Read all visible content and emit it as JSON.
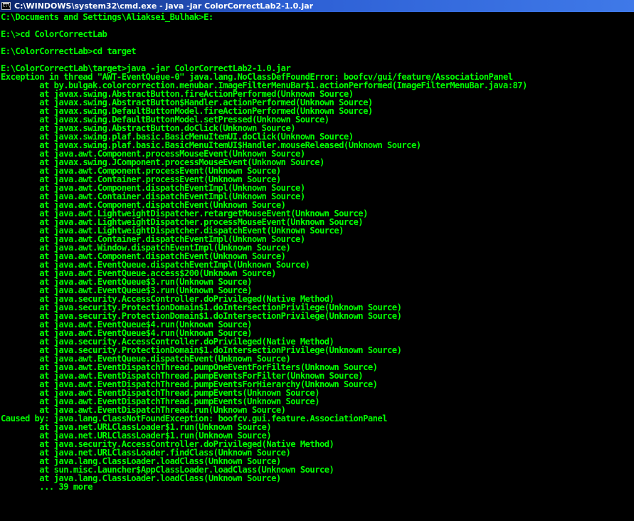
{
  "window": {
    "title": "C:\\WINDOWS\\system32\\cmd.exe - java -jar ColorCorrectLab2-1.0.jar",
    "icon": "cmd-icon",
    "icon_glyph": "C:\\"
  },
  "colors": {
    "background": "#000000",
    "text": "#00ff00",
    "titlebar_start": "#0a246a",
    "titlebar_end": "#3f79e8"
  },
  "console": {
    "lines": [
      "C:\\Documents and Settings\\Aliaksei_Bulhak>E:",
      "",
      "E:\\>cd ColorCorrectLab",
      "",
      "E:\\ColorCorrectLab>cd target",
      "",
      "E:\\ColorCorrectLab\\target>java -jar ColorCorrectLab2-1.0.jar",
      "Exception in thread \"AWT-EventQueue-0\" java.lang.NoClassDefFoundError: boofcv/gui/feature/AssociationPanel",
      "        at by.bulgak.colorcorrection.menubar.ImageFilterMenuBar$1.actionPerformed(ImageFilterMenuBar.java:87)",
      "        at javax.swing.AbstractButton.fireActionPerformed(Unknown Source)",
      "        at javax.swing.AbstractButton$Handler.actionPerformed(Unknown Source)",
      "        at javax.swing.DefaultButtonModel.fireActionPerformed(Unknown Source)",
      "        at javax.swing.DefaultButtonModel.setPressed(Unknown Source)",
      "        at javax.swing.AbstractButton.doClick(Unknown Source)",
      "        at javax.swing.plaf.basic.BasicMenuItemUI.doClick(Unknown Source)",
      "        at javax.swing.plaf.basic.BasicMenuItemUI$Handler.mouseReleased(Unknown Source)",
      "        at java.awt.Component.processMouseEvent(Unknown Source)",
      "        at javax.swing.JComponent.processMouseEvent(Unknown Source)",
      "        at java.awt.Component.processEvent(Unknown Source)",
      "        at java.awt.Container.processEvent(Unknown Source)",
      "        at java.awt.Component.dispatchEventImpl(Unknown Source)",
      "        at java.awt.Container.dispatchEventImpl(Unknown Source)",
      "        at java.awt.Component.dispatchEvent(Unknown Source)",
      "        at java.awt.LightweightDispatcher.retargetMouseEvent(Unknown Source)",
      "        at java.awt.LightweightDispatcher.processMouseEvent(Unknown Source)",
      "        at java.awt.LightweightDispatcher.dispatchEvent(Unknown Source)",
      "        at java.awt.Container.dispatchEventImpl(Unknown Source)",
      "        at java.awt.Window.dispatchEventImpl(Unknown Source)",
      "        at java.awt.Component.dispatchEvent(Unknown Source)",
      "        at java.awt.EventQueue.dispatchEventImpl(Unknown Source)",
      "        at java.awt.EventQueue.access$200(Unknown Source)",
      "        at java.awt.EventQueue$3.run(Unknown Source)",
      "        at java.awt.EventQueue$3.run(Unknown Source)",
      "        at java.security.AccessController.doPrivileged(Native Method)",
      "        at java.security.ProtectionDomain$1.doIntersectionPrivilege(Unknown Source)",
      "        at java.security.ProtectionDomain$1.doIntersectionPrivilege(Unknown Source)",
      "        at java.awt.EventQueue$4.run(Unknown Source)",
      "        at java.awt.EventQueue$4.run(Unknown Source)",
      "        at java.security.AccessController.doPrivileged(Native Method)",
      "        at java.security.ProtectionDomain$1.doIntersectionPrivilege(Unknown Source)",
      "        at java.awt.EventQueue.dispatchEvent(Unknown Source)",
      "        at java.awt.EventDispatchThread.pumpOneEventForFilters(Unknown Source)",
      "        at java.awt.EventDispatchThread.pumpEventsForFilter(Unknown Source)",
      "        at java.awt.EventDispatchThread.pumpEventsForHierarchy(Unknown Source)",
      "        at java.awt.EventDispatchThread.pumpEvents(Unknown Source)",
      "        at java.awt.EventDispatchThread.pumpEvents(Unknown Source)",
      "        at java.awt.EventDispatchThread.run(Unknown Source)",
      "Caused by: java.lang.ClassNotFoundException: boofcv.gui.feature.AssociationPanel",
      "        at java.net.URLClassLoader$1.run(Unknown Source)",
      "        at java.net.URLClassLoader$1.run(Unknown Source)",
      "        at java.security.AccessController.doPrivileged(Native Method)",
      "        at java.net.URLClassLoader.findClass(Unknown Source)",
      "        at java.lang.ClassLoader.loadClass(Unknown Source)",
      "        at sun.misc.Launcher$AppClassLoader.loadClass(Unknown Source)",
      "        at java.lang.ClassLoader.loadClass(Unknown Source)",
      "        ... 39 more"
    ]
  }
}
